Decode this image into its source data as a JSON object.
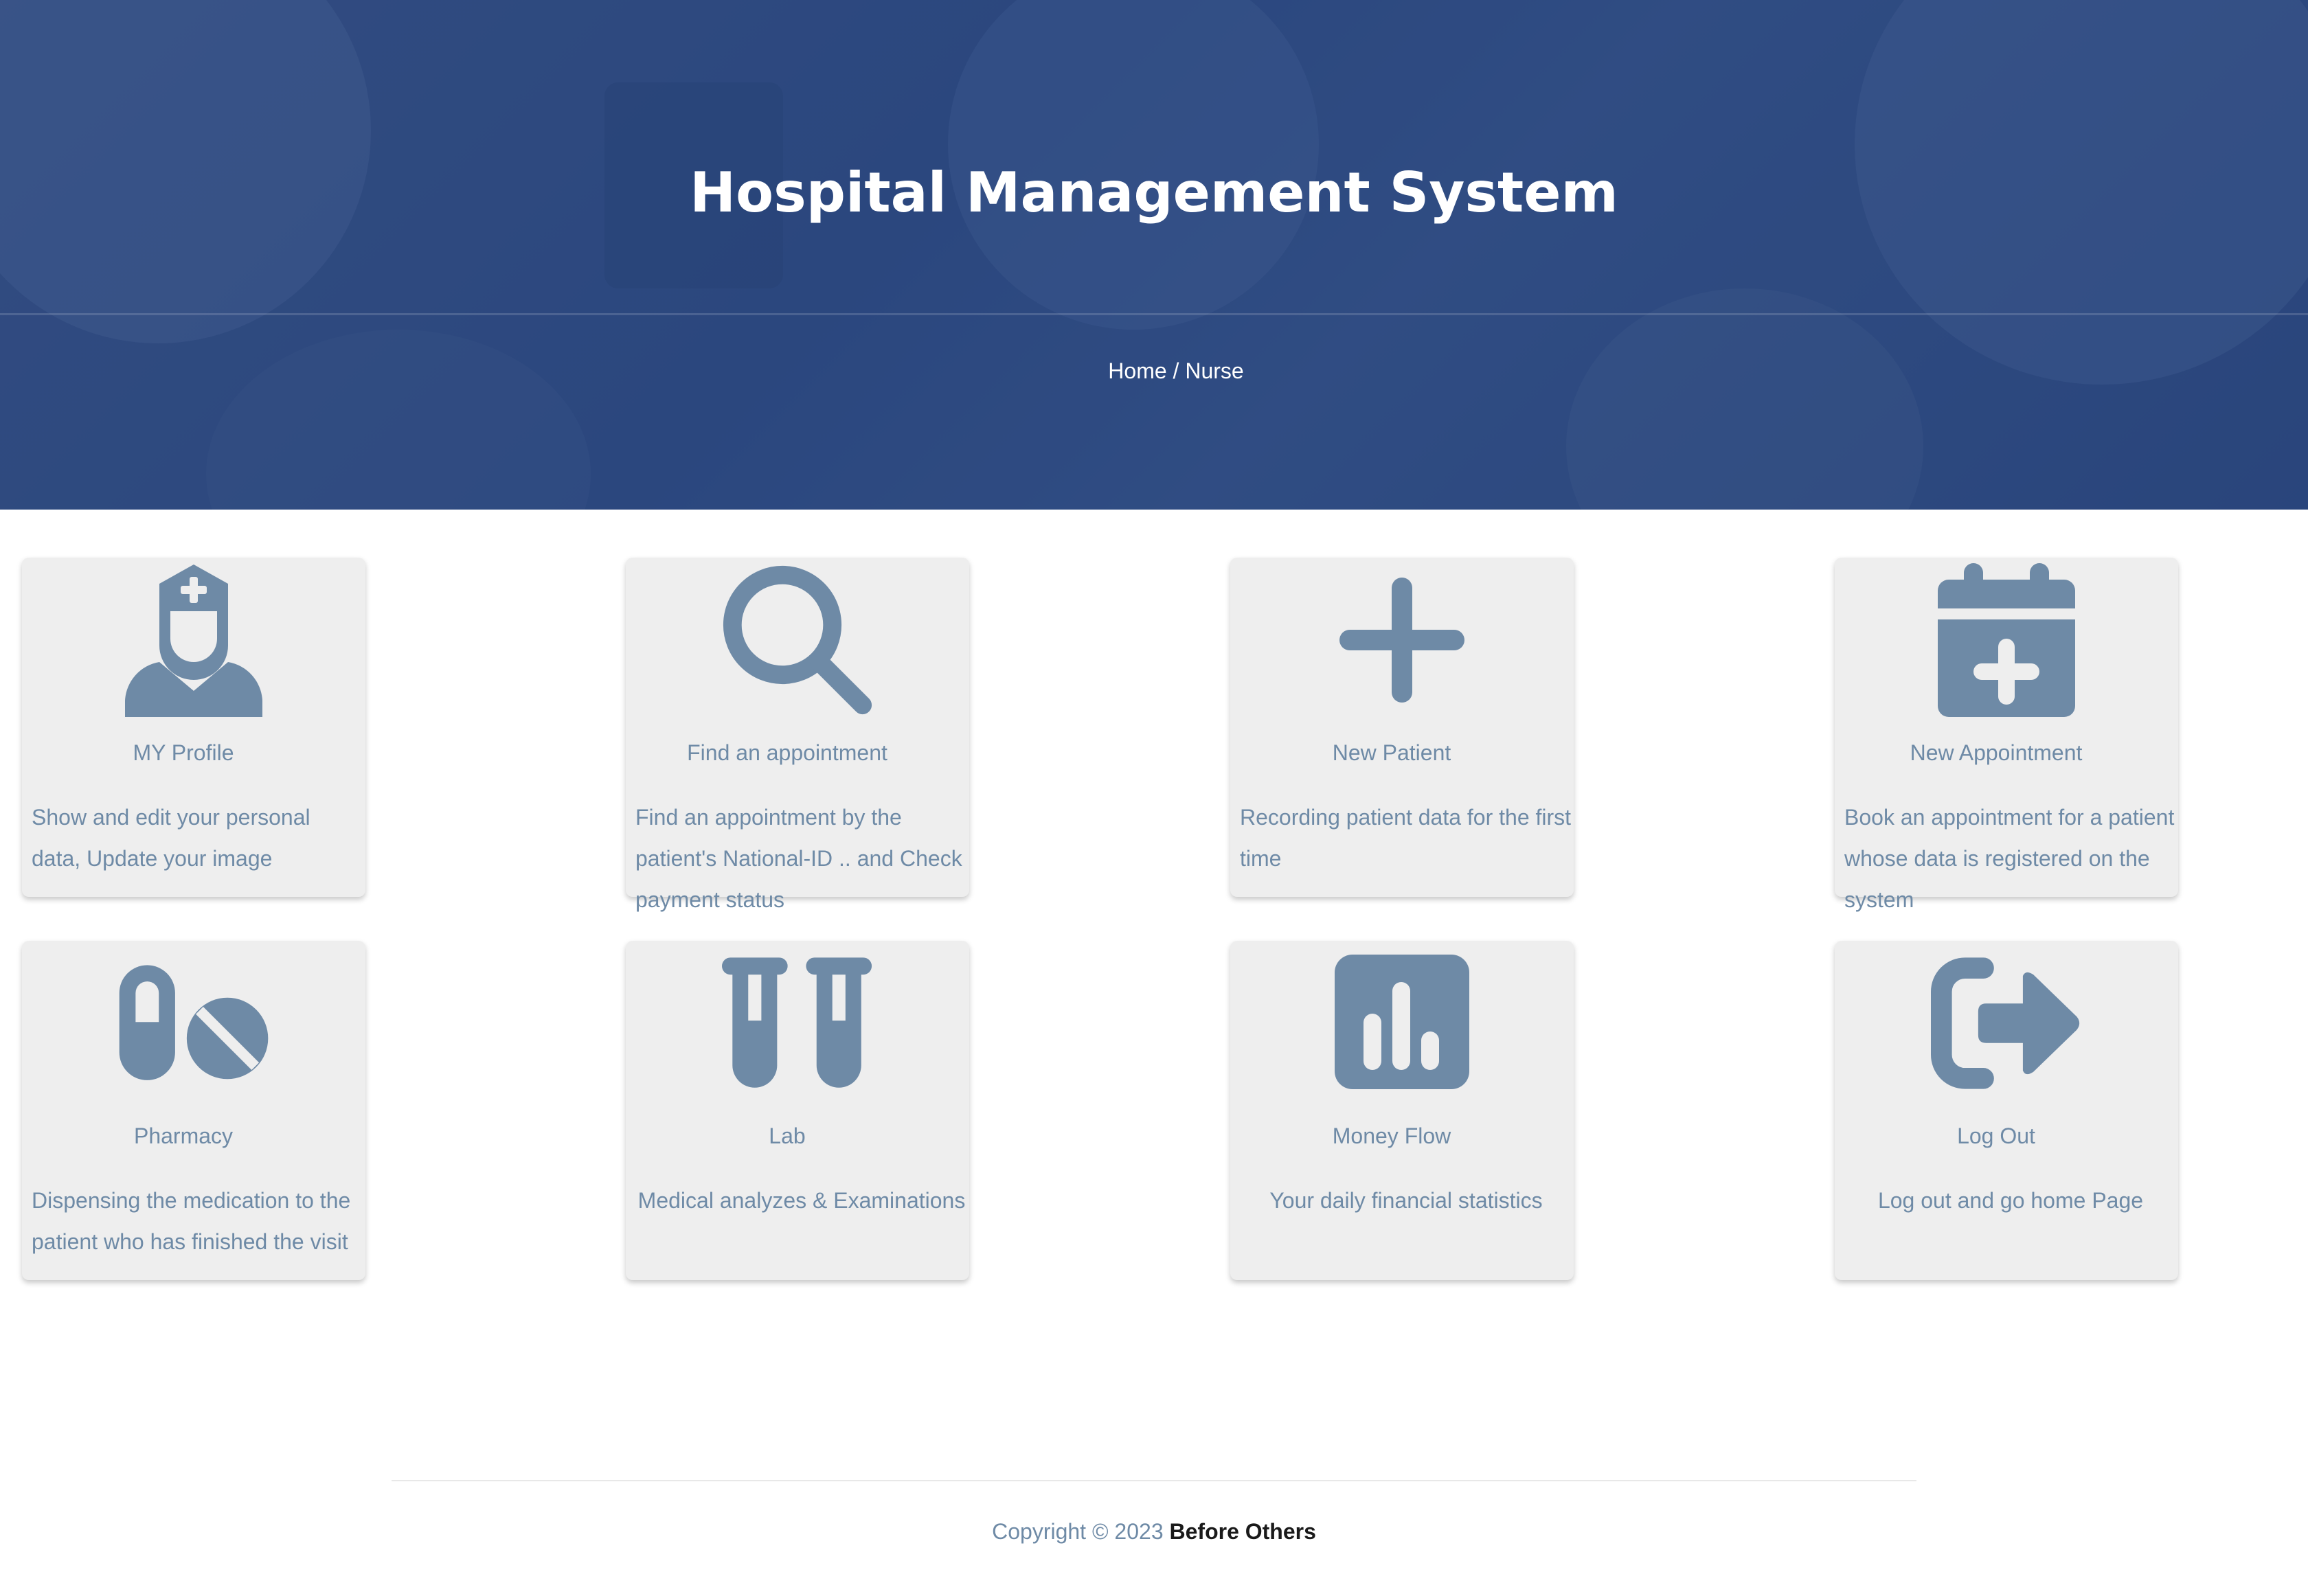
{
  "header": {
    "title": "Hospital Management System",
    "breadcrumb_home": "Home",
    "breadcrumb_separator": " / ",
    "breadcrumb_current": "Nurse"
  },
  "colors": {
    "icon": "#6e8aa6",
    "card_bg": "#eeeeee",
    "hero_overlay": "#2f4e86"
  },
  "cards": [
    {
      "icon": "nurse-icon",
      "title": "MY Profile",
      "description": "Show and edit your personal data, Update your image"
    },
    {
      "icon": "search-icon",
      "title": "Find an appointment",
      "description": "Find an appointment by the patient's National-ID .. and Check payment status"
    },
    {
      "icon": "plus-icon",
      "title": "New Patient",
      "description": "Recording patient data for the first time"
    },
    {
      "icon": "calendar-plus-icon",
      "title": "New Appointment",
      "description": "Book an appointment for a patient whose data is registered on the system"
    },
    {
      "icon": "pills-icon",
      "title": "Pharmacy",
      "description": "Dispensing the medication to the patient who has finished the visit"
    },
    {
      "icon": "test-tubes-icon",
      "title": "Lab",
      "description": "Medical analyzes & Examinations"
    },
    {
      "icon": "chart-square-icon",
      "title": "Money Flow",
      "description": "Your daily financial statistics"
    },
    {
      "icon": "logout-icon",
      "title": "Log Out",
      "description": "Log out and go home Page"
    }
  ],
  "footer": {
    "copyright": "Copyright © 2023 ",
    "brand": "Before Others"
  }
}
